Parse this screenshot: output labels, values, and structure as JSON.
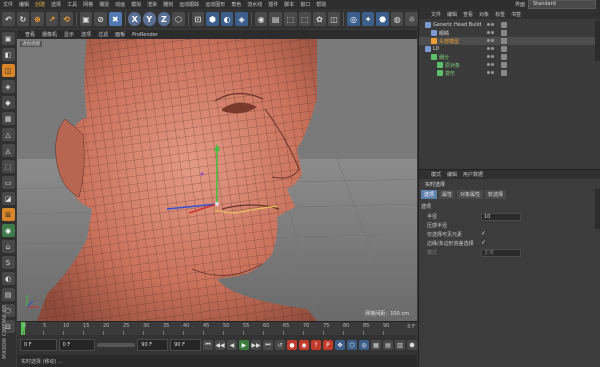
{
  "menubar": {
    "items": [
      "文件",
      "编辑",
      "创建",
      "选择",
      "工具",
      "网格",
      "捕捉",
      "动画",
      "模拟",
      "渲染",
      "雕刻",
      "运动跟踪",
      "运动图形",
      "角色",
      "流水线",
      "插件",
      "脚本",
      "窗口",
      "帮助"
    ],
    "active_index": 2,
    "layout_label": "界面",
    "layout_value": "Standard"
  },
  "toolbar": {
    "buttons": [
      "↶",
      "↻",
      "⊕",
      "↗",
      "⟲",
      "▣",
      "⊘",
      "✖",
      "X",
      "Y",
      "Z",
      "⬡",
      "⊡",
      "⬢",
      "◐",
      "◈",
      "◉",
      "▤",
      "⬚",
      "⬚",
      "✿",
      "◫",
      "◎",
      "✦",
      "⬣",
      "◍",
      "☼"
    ]
  },
  "lefttools": [
    "▣",
    "◧",
    "◫",
    "◈",
    "◆",
    "▦",
    "△",
    "◬",
    "⬚",
    "▭",
    "◪",
    "⊞",
    "◉",
    "⌂",
    "S",
    "◐",
    "▤",
    "⬡",
    "⊟"
  ],
  "maxon_text": "MAXON CINEMA 4D",
  "viewport": {
    "menu": [
      "查看",
      "摄像机",
      "显示",
      "选项",
      "过滤",
      "面板",
      "ProRender"
    ],
    "label": "透视视图",
    "grid_status": "网格间距：100 cm"
  },
  "timeline": {
    "ticks": [
      "0",
      "5",
      "10",
      "15",
      "20",
      "25",
      "30",
      "35",
      "40",
      "45",
      "50",
      "55",
      "60",
      "65",
      "70",
      "75",
      "80",
      "85",
      "90"
    ],
    "end": "0 F"
  },
  "transport": {
    "start_frame": "0 F",
    "current_frame": "0 F",
    "end_frame": "90 F",
    "end_frame2": "90 F",
    "buttons": [
      "⏮",
      "◀◀",
      "◀",
      "▶",
      "▶▶",
      "⏭",
      "↺",
      "●",
      "◉",
      "?",
      "P",
      "✥",
      "⬡",
      "◎",
      "▦",
      "▤",
      "▥",
      "⬢"
    ]
  },
  "statusbar": "实时选择 (移动) ...",
  "object_manager": {
    "menu": [
      "文件",
      "编辑",
      "查看",
      "对象",
      "标签",
      "书签"
    ],
    "objects": [
      {
        "name": "Generic Head Build",
        "style": "normal",
        "indent": 0
      },
      {
        "name": "眼睛",
        "style": "normal",
        "indent": 1
      },
      {
        "name": "头部模型",
        "style": "hl",
        "indent": 1
      },
      {
        "name": "L0",
        "style": "normal",
        "indent": 0
      },
      {
        "name": "细分",
        "style": "gr",
        "indent": 1
      },
      {
        "name": "原对象",
        "style": "gr",
        "indent": 2
      },
      {
        "name": "变形",
        "style": "gr",
        "indent": 2
      }
    ]
  },
  "attributes": {
    "menu": [
      "模式",
      "编辑",
      "用户数据"
    ],
    "title": "实时选择",
    "tabs": [
      "选项",
      "属性",
      "对象属性",
      "软选择"
    ],
    "active_tab": 0,
    "section": "选项",
    "rows": [
      {
        "label": "半径",
        "value": "10",
        "kind": "field"
      },
      {
        "label": "压感半径",
        "value": "",
        "kind": "check"
      },
      {
        "label": "仅选择可见元素",
        "value": "✓",
        "kind": "check"
      },
      {
        "label": "边缘/多边形容差选择",
        "value": "✓",
        "kind": "check"
      },
      {
        "label": "模式",
        "value": "正常",
        "kind": "field",
        "dim": true
      }
    ]
  },
  "colors": {
    "accent": "#f0a030",
    "selected": "#4f79b0",
    "skin": "#c8705a",
    "axis_green": "#3fbf3f",
    "axis_red": "#d03030",
    "axis_blue": "#3050d0"
  }
}
